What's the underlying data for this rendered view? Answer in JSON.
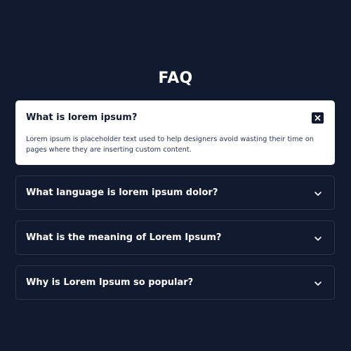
{
  "header": {
    "title": "FAQ"
  },
  "faq": {
    "items": [
      {
        "question": "What is lorem ipsum?",
        "answer": "Lorem ipsum is placeholder text used to help designers avoid wasting their time on pages where they are inserting custom content.",
        "expanded": true,
        "toggle_icon": "close-icon"
      },
      {
        "question": "What language is lorem ipsum dolor?",
        "expanded": false,
        "toggle_icon": "chevron-down-icon"
      },
      {
        "question": "What is the meaning of Lorem Ipsum?",
        "expanded": false,
        "toggle_icon": "chevron-down-icon"
      },
      {
        "question": "Why is Lorem Ipsum so popular?",
        "expanded": false,
        "toggle_icon": "chevron-down-icon"
      }
    ]
  },
  "colors": {
    "background": "#111a2e",
    "card_open": "#ffffff",
    "border": "#2a3650",
    "text_light": "#ffffff"
  }
}
